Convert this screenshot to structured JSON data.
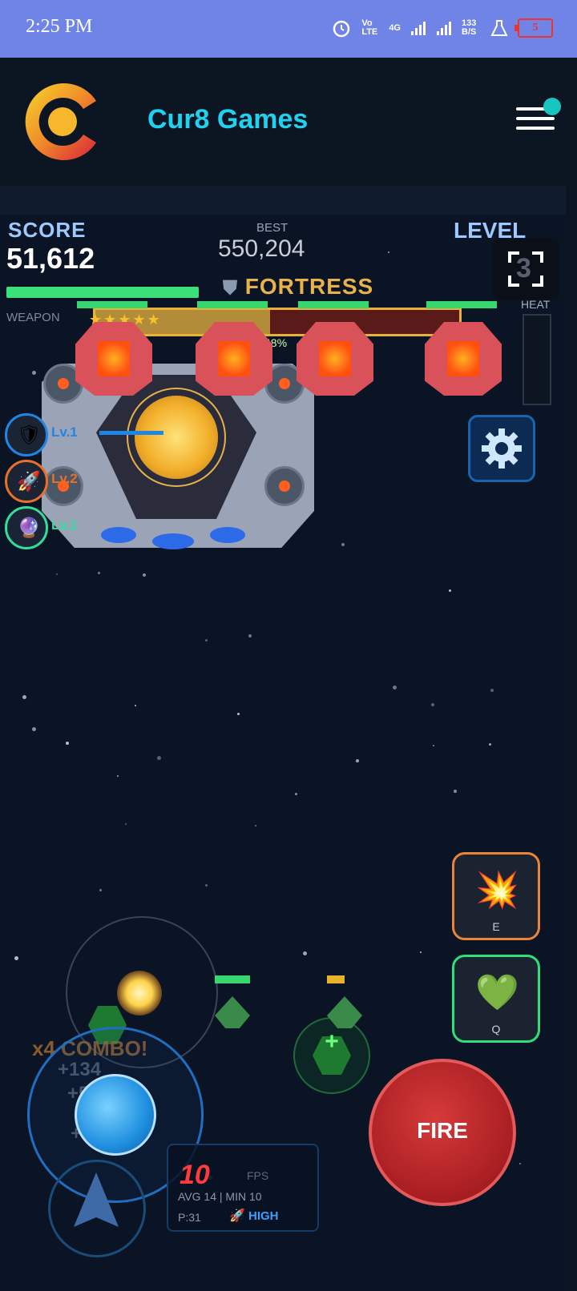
{
  "status_bar": {
    "time": "2:25 PM",
    "volte": "Vo LTE",
    "network": "4G",
    "data_rate": "133 B/S",
    "battery": "5"
  },
  "app": {
    "title": "Cur8 Games",
    "colors": {
      "accent": "#1fd3f0",
      "notification": "#17c6c0"
    }
  },
  "hud": {
    "score_label": "SCORE",
    "score_value": "51,612",
    "best_label": "BEST",
    "best_value": "550,204",
    "level_label": "LEVEL",
    "level_value": "3",
    "weapon_label": "WEAPON",
    "heat_label": "HEAT",
    "boss_name": "FORTRESS",
    "boss_health_pct": "48%"
  },
  "powerups": [
    {
      "name": "shield",
      "level": "Lv.1",
      "color": "#1e86e6"
    },
    {
      "name": "rocket",
      "level": "Lv.2",
      "color": "#e8702a"
    },
    {
      "name": "orb",
      "level": "Lv.1",
      "color": "#2fe09a"
    }
  ],
  "abilities": {
    "bomb_key": "E",
    "heal_key": "Q"
  },
  "combo": {
    "label": "x4 COMBO!",
    "points": [
      "+134",
      "+55",
      "+96"
    ]
  },
  "controls": {
    "fire_label": "FIRE"
  },
  "perf": {
    "fps_value": "10",
    "fps_label": "FPS",
    "avg_min": "AVG 14 | MIN 10",
    "particles": "P:31",
    "quality": "HIGH"
  }
}
